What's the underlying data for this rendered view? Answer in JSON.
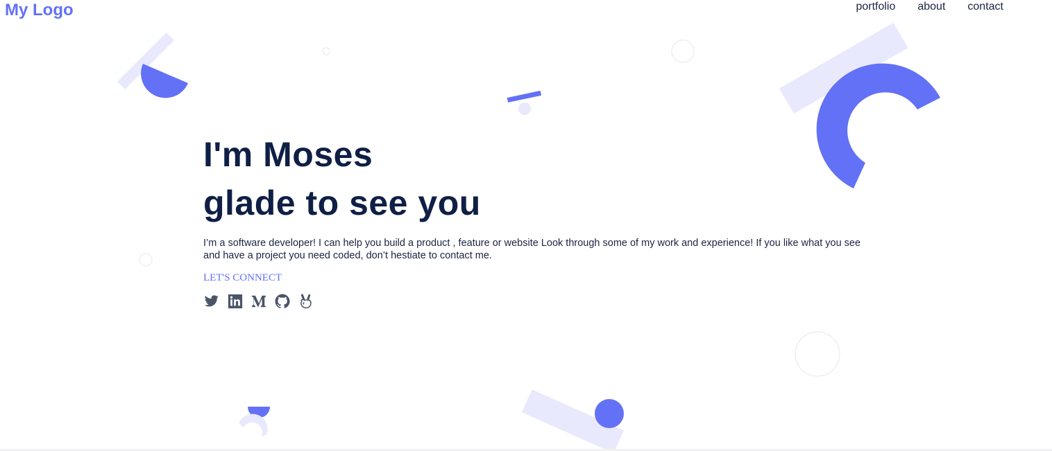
{
  "header": {
    "logo": "My Logo",
    "nav": [
      {
        "label": "portfolio"
      },
      {
        "label": "about"
      },
      {
        "label": "contact"
      }
    ]
  },
  "hero": {
    "title_line1": "I'm Moses",
    "title_line2": "glade to see you",
    "description": "I’m a software developer! I can help you build a product , feature or website Look through some of my work and experience! If you like what you see and have a project you need coded, don’t hestiate to contact me.",
    "cta_label": "LET'S CONNECT"
  },
  "socials": [
    {
      "icon": "twitter-icon"
    },
    {
      "icon": "linkedin-icon"
    },
    {
      "icon": "medium-icon"
    },
    {
      "icon": "github-icon"
    },
    {
      "icon": "angellist-icon"
    }
  ],
  "colors": {
    "accent": "#6371f6",
    "accent_light": "#e8e9fd",
    "heading": "#0f1f45",
    "icon": "#4a5568"
  }
}
